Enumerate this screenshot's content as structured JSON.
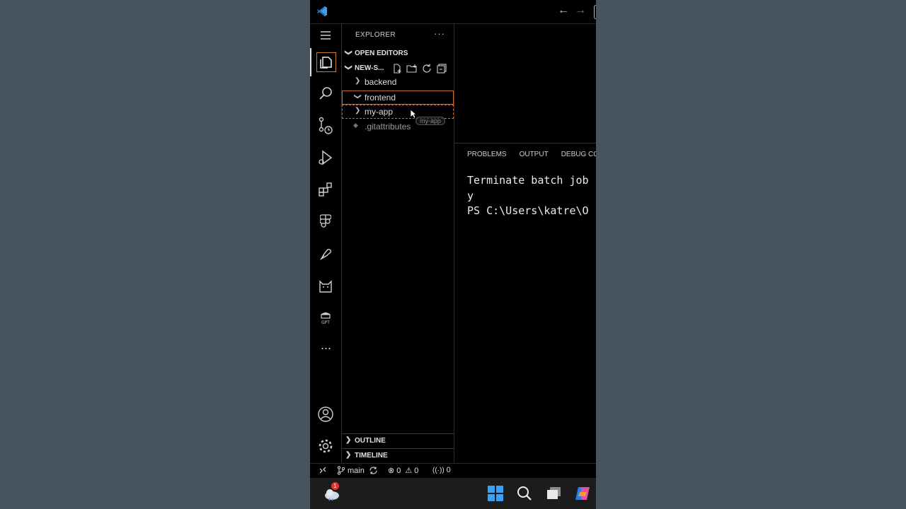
{
  "sidebar": {
    "title": "EXPLORER",
    "open_editors_label": "OPEN EDITORS",
    "folder_label": "NEW-S...",
    "tree": [
      {
        "label": "backend",
        "expanded": false
      },
      {
        "label": "frontend",
        "expanded": true
      },
      {
        "label": "my-app",
        "expanded": false
      },
      {
        "label": ".gitattributes"
      }
    ],
    "drag_ghost": "my-app",
    "outline_label": "OUTLINE",
    "timeline_label": "TIMELINE"
  },
  "activity_bar": {
    "icons": [
      "menu-icon",
      "explorer-icon",
      "search-icon",
      "source-control-icon",
      "run-debug-icon",
      "extensions-icon",
      "figma-icon",
      "pen-icon",
      "cat-icon",
      "gpt-icon",
      "more-icon",
      "account-icon",
      "settings-icon"
    ],
    "more_label": "···"
  },
  "panel": {
    "tabs": [
      "PROBLEMS",
      "OUTPUT",
      "DEBUG CO"
    ],
    "terminal_lines": [
      "Terminate batch job",
      "y",
      "PS C:\\Users\\katre\\O"
    ]
  },
  "status_bar": {
    "branch": "main",
    "errors": "0",
    "warnings": "0",
    "ports": "0"
  },
  "taskbar": {
    "notification_count": "1",
    "icons": [
      "weather-icon",
      "windows-start-icon",
      "search-icon",
      "task-view-icon",
      "copilot-icon"
    ]
  },
  "colors": {
    "accent_orange": "#c86a35",
    "background": "#46545d"
  }
}
